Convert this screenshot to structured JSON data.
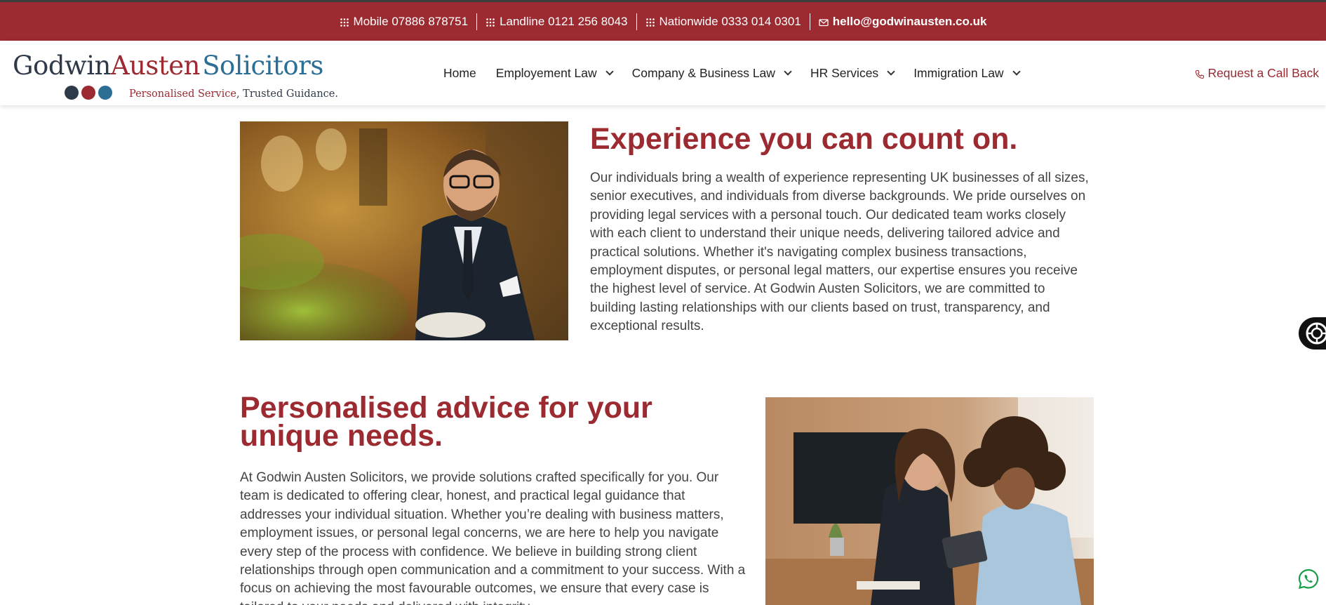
{
  "topbar": {
    "items": [
      {
        "icon": "keypad-icon",
        "text": "Mobile 07886 878751"
      },
      {
        "icon": "keypad-icon",
        "text": "Landline 0121 256 8043"
      },
      {
        "icon": "keypad-icon",
        "text": "Nationwide 0333 014 0301"
      },
      {
        "icon": "mail-icon",
        "text": "hello@godwinausten.co.uk"
      }
    ]
  },
  "logo": {
    "word1": "Godwin",
    "word2": "Austen",
    "word3": "Solicitors",
    "tag_red": "Personalised Service",
    "tag_rest": ", Trusted Guidance."
  },
  "nav": {
    "items": [
      {
        "label": "Home",
        "dropdown": false
      },
      {
        "label": "Employement Law",
        "dropdown": true
      },
      {
        "label": "Company & Business Law",
        "dropdown": true
      },
      {
        "label": "HR Services",
        "dropdown": true
      },
      {
        "label": "Immigration Law",
        "dropdown": true
      }
    ],
    "callback": "Request a Call Back"
  },
  "section1": {
    "heading": "Experience you can count on.",
    "body": "Our individuals bring a wealth of experience representing UK businesses of all sizes, senior executives, and individuals from diverse backgrounds. We pride ourselves on providing legal services with a personal touch. Our dedicated team works closely with each client to understand their unique needs, delivering tailored advice and practical solutions. Whether it's navigating complex business transactions, employment disputes, or personal legal matters, our expertise ensures you receive the highest level of service. At Godwin Austen Solicitors, we are committed to building lasting relationships with our clients based on trust, transparency, and exceptional results."
  },
  "section2": {
    "heading": "Personalised advice for your unique needs.",
    "body": "At Godwin Austen Solicitors, we provide solutions crafted specifically for you. Our team is dedicated to offering clear, honest, and practical legal guidance that addresses your individual situation. Whether you’re dealing with business matters, employment issues, or personal legal concerns, we are here to help you navigate every step of the process with confidence. We believe in building strong client relationships through open communication and a commitment to your success. With a focus on achieving the most favourable outcomes, we ensure that every case is tailored to your needs and delivered with integrity."
  },
  "colors": {
    "brand_red": "#9b2a31",
    "brand_navy": "#2e3a48",
    "brand_blue": "#2d6e95"
  }
}
